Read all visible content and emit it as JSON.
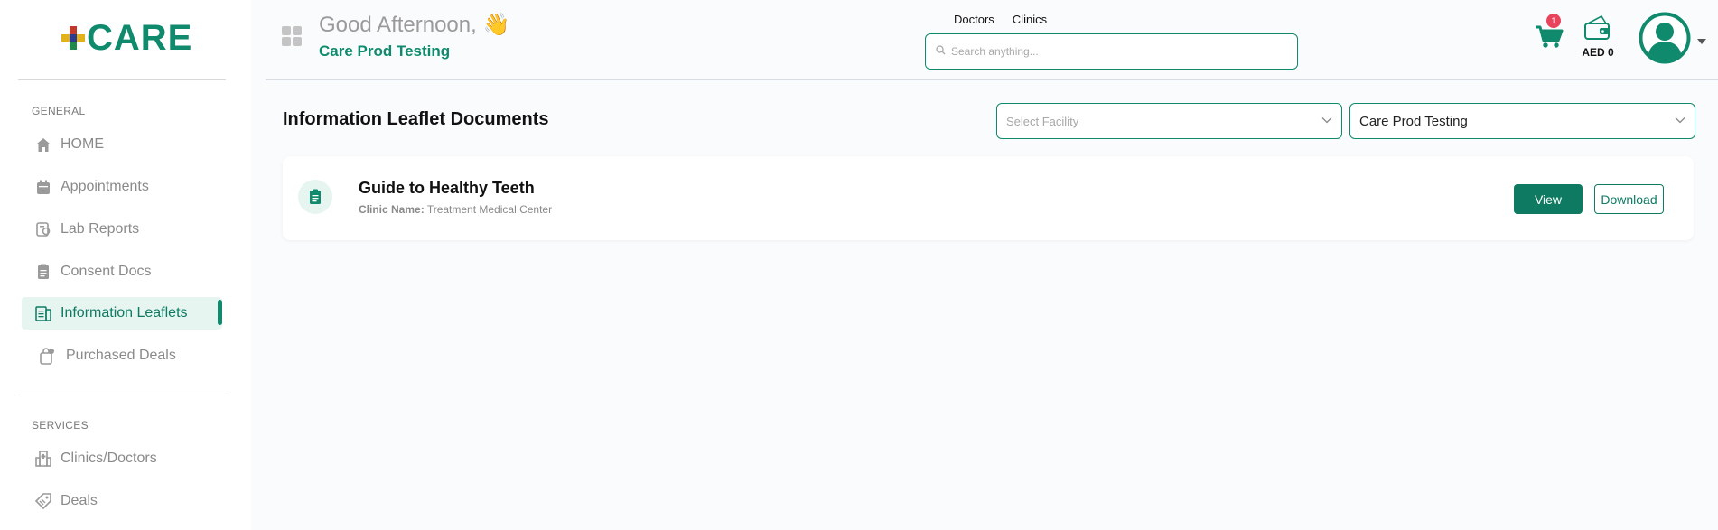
{
  "brand": {
    "logo_text": "CARE",
    "accent": "#0f8a6c"
  },
  "sidebar": {
    "general_label": "GENERAL",
    "services_label": "SERVICES",
    "general_items": [
      {
        "label": "HOME",
        "icon": "home-icon"
      },
      {
        "label": "Appointments",
        "icon": "calendar-icon"
      },
      {
        "label": "Lab Reports",
        "icon": "lab-icon"
      },
      {
        "label": "Consent Docs",
        "icon": "clipboard-icon"
      },
      {
        "label": "Information Leaflets",
        "icon": "leaflet-icon",
        "active": true
      },
      {
        "label": "Purchased Deals",
        "icon": "deals-bag-icon"
      }
    ],
    "service_items": [
      {
        "label": "Clinics/Doctors",
        "icon": "building-icon"
      },
      {
        "label": "Deals",
        "icon": "tag-icon"
      }
    ]
  },
  "header": {
    "greeting": "Good Afternoon, 👋",
    "org_name": "Care Prod Testing",
    "search_tabs": [
      "Doctors",
      "Clinics"
    ],
    "search_placeholder": "Search anything...",
    "cart_count": "1",
    "wallet_label": "AED 0"
  },
  "main": {
    "title": "Information Leaflet Documents",
    "facility_select_placeholder": "Select Facility",
    "org_select_value": "Care Prod Testing",
    "documents": [
      {
        "title": "Guide to Healthy Teeth",
        "clinic_label": "Clinic Name:",
        "clinic_name": "Treatment Medical Center",
        "view_label": "View",
        "download_label": "Download"
      }
    ]
  }
}
